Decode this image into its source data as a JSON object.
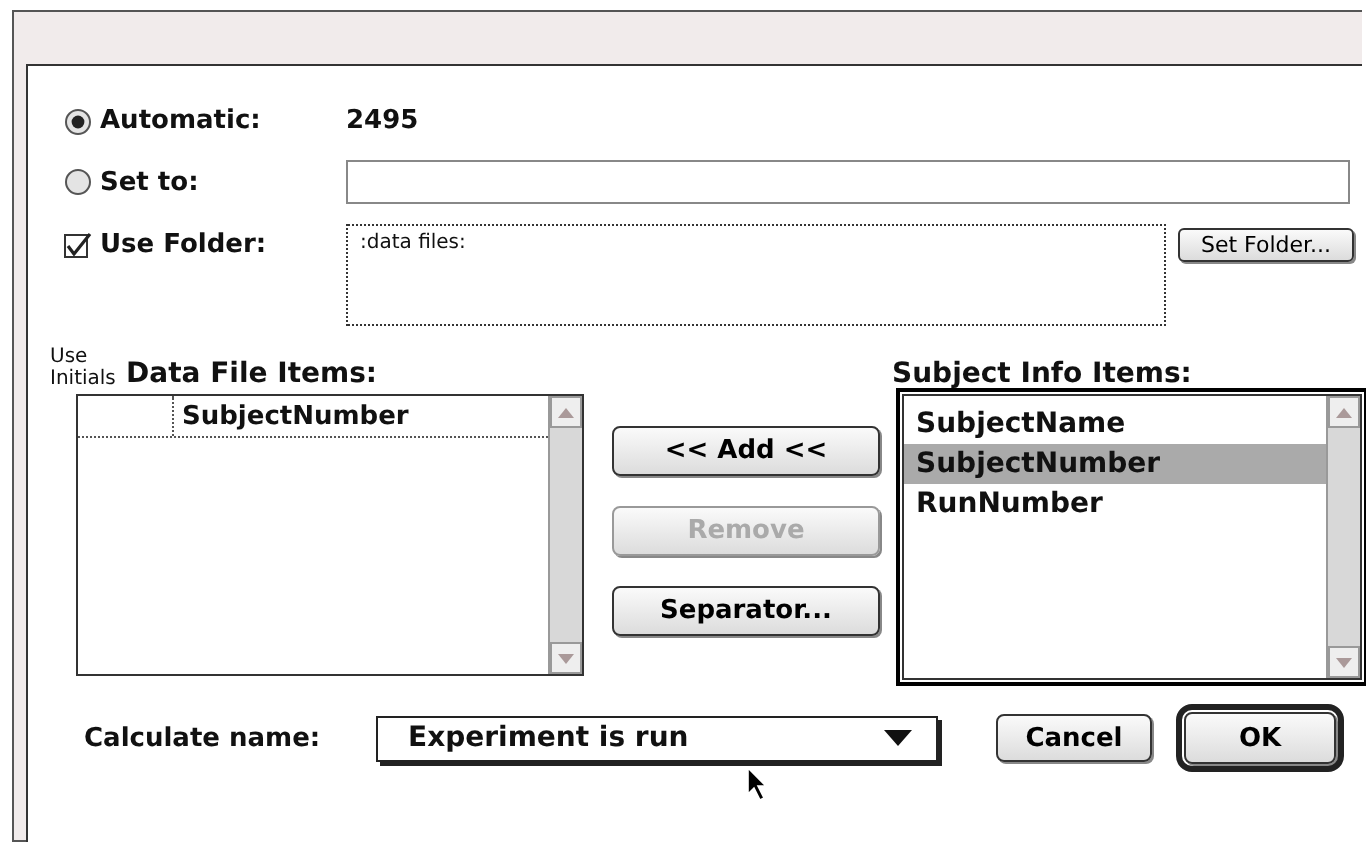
{
  "options": [
    {
      "kind": "radio",
      "label": "Automatic:",
      "selected": true,
      "value": "2495"
    },
    {
      "kind": "radio_field",
      "label": "Set to:",
      "selected": false
    }
  ],
  "use_folder": {
    "label": "Use Folder:",
    "checked": true,
    "path": ":data files:",
    "button": "Set Folder..."
  },
  "data_file_items": {
    "initials_heading": "Use Initials",
    "title": "Data File Items:",
    "rows": [
      "SubjectNumber"
    ]
  },
  "middle_buttons": [
    {
      "label": "<< Add <<",
      "disabled": false
    },
    {
      "label": "Remove",
      "disabled": true
    },
    {
      "label": "Separator...",
      "disabled": false
    }
  ],
  "subject_info_items": {
    "title": "Subject Info Items:",
    "items": [
      {
        "label": "SubjectName",
        "selected": false
      },
      {
        "label": "SubjectNumber",
        "selected": true
      },
      {
        "label": "RunNumber",
        "selected": false
      }
    ]
  },
  "calculate": {
    "label": "Calculate name:",
    "value": "Experiment is run"
  },
  "dialog_buttons": [
    {
      "label": "Cancel",
      "default": false
    },
    {
      "label": "OK",
      "default": true
    }
  ]
}
